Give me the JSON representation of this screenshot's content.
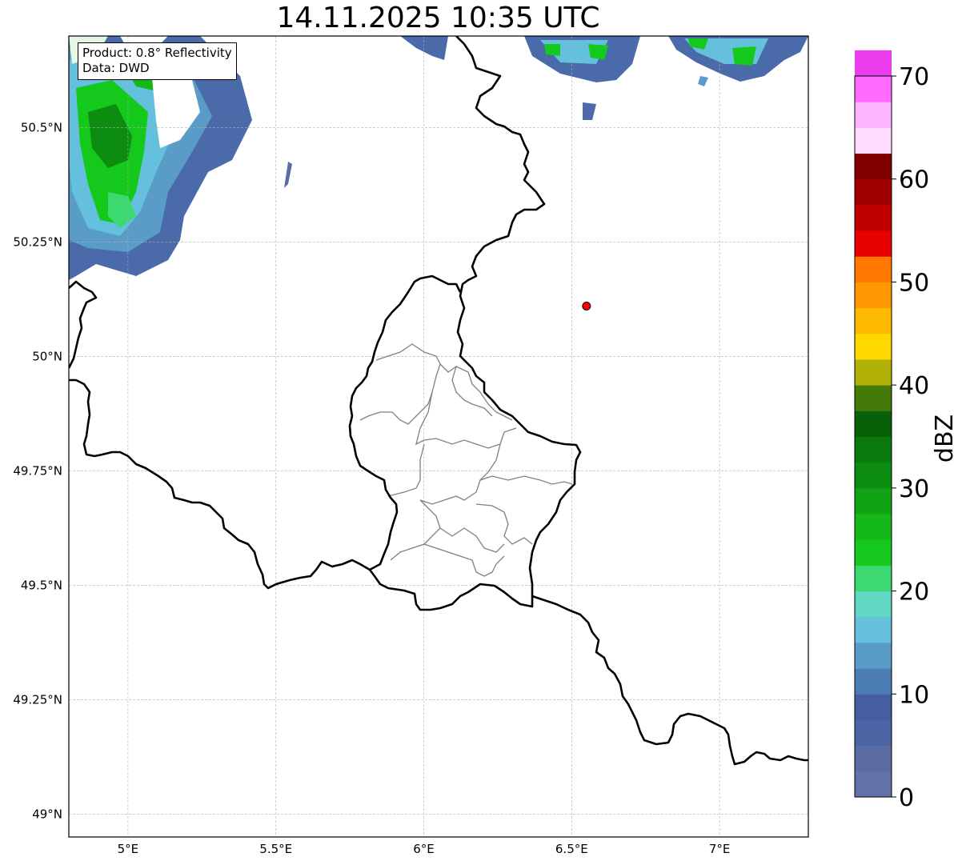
{
  "title": "14.11.2025 10:35 UTC",
  "info_box": {
    "product": "Product: 0.8° Reflectivity",
    "data": "Data: DWD"
  },
  "axes": {
    "lon_ticks": [
      {
        "value": 5.0,
        "label": "5°E"
      },
      {
        "value": 5.5,
        "label": "5.5°E"
      },
      {
        "value": 6.0,
        "label": "6°E"
      },
      {
        "value": 6.5,
        "label": "6.5°E"
      },
      {
        "value": 7.0,
        "label": "7°E"
      }
    ],
    "lat_ticks": [
      {
        "value": 50.5,
        "label": "50.5°N"
      },
      {
        "value": 50.25,
        "label": "50.25°N"
      },
      {
        "value": 50.0,
        "label": "50°N"
      },
      {
        "value": 49.75,
        "label": "49.75°N"
      },
      {
        "value": 49.5,
        "label": "49.5°N"
      },
      {
        "value": 49.25,
        "label": "49.25°N"
      },
      {
        "value": 49.0,
        "label": "49°N"
      }
    ],
    "lon_range": [
      4.8,
      7.3
    ],
    "lat_range": [
      48.95,
      50.7
    ],
    "grid": true
  },
  "marker": {
    "lon": 6.55,
    "lat": 50.11,
    "color": "#ff0000"
  },
  "colorbar": {
    "label": "dBZ",
    "min": 0,
    "max": 70,
    "step": 2.5,
    "ticks": [
      {
        "value": 0,
        "label": "0"
      },
      {
        "value": 10,
        "label": "10"
      },
      {
        "value": 20,
        "label": "20"
      },
      {
        "value": 30,
        "label": "30"
      },
      {
        "value": 40,
        "label": "40"
      },
      {
        "value": 50,
        "label": "50"
      },
      {
        "value": 60,
        "label": "60"
      },
      {
        "value": 70,
        "label": "70"
      }
    ],
    "colors": [
      "#6272a6",
      "#5a6ca2",
      "#4c64a4",
      "#445ea0",
      "#4c7cb4",
      "#5a9cc8",
      "#64c0dc",
      "#60d8c4",
      "#3cd870",
      "#14c81c",
      "#14b818",
      "#10a414",
      "#0c8c10",
      "#0a7a0e",
      "#086008",
      "#467a08",
      "#b0b008",
      "#ffd800",
      "#ffb800",
      "#ff9800",
      "#ff7800",
      "#e80000",
      "#c00000",
      "#a00000",
      "#800000",
      "#ffdcff",
      "#ffb4ff",
      "#ff6cff",
      "#ea3cea"
    ]
  },
  "colors": {
    "border": "#000000",
    "admin_border": "#808080",
    "grid": "#b0b0b0"
  }
}
